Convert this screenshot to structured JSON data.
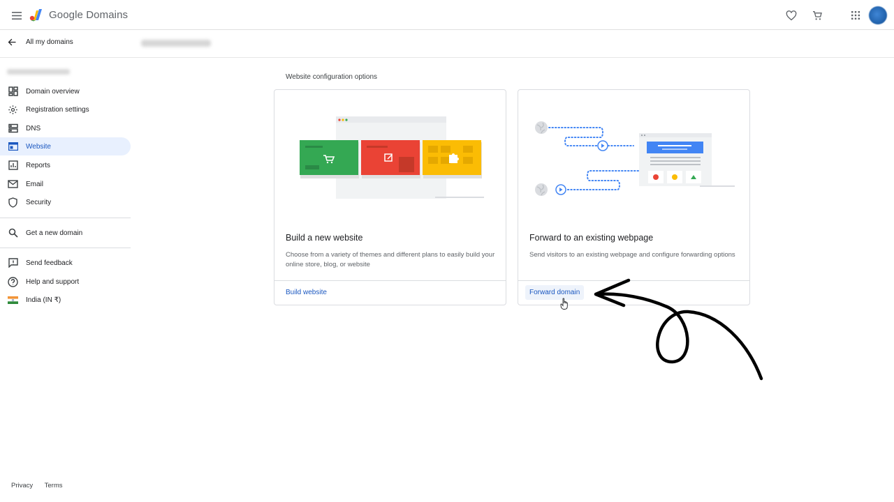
{
  "app": {
    "logo_text": "Google Domains"
  },
  "header": {
    "icons": [
      "menu-icon",
      "favorites-heart-icon",
      "cart-icon",
      "apps-grid-icon",
      "account-avatar"
    ]
  },
  "subbar": {
    "back_label": "All my domains"
  },
  "sidebar": {
    "items": [
      {
        "label": "Domain overview",
        "icon": "dashboard-icon"
      },
      {
        "label": "Registration settings",
        "icon": "settings-gear-icon"
      },
      {
        "label": "DNS",
        "icon": "dns-icon"
      },
      {
        "label": "Website",
        "icon": "website-icon",
        "active": true
      },
      {
        "label": "Reports",
        "icon": "reports-icon"
      },
      {
        "label": "Email",
        "icon": "email-icon"
      },
      {
        "label": "Security",
        "icon": "shield-icon"
      }
    ],
    "secondary": [
      {
        "label": "Get a new domain",
        "icon": "search-icon"
      }
    ],
    "tertiary": [
      {
        "label": "Send feedback",
        "icon": "feedback-icon"
      },
      {
        "label": "Help and support",
        "icon": "help-icon"
      },
      {
        "label": "India (IN ₹)",
        "icon": "india-flag-icon"
      }
    ]
  },
  "main": {
    "section_title": "Website configuration options",
    "cards": [
      {
        "title": "Build a new website",
        "description": "Choose from a variety of themes and different plans to easily build your online store, blog, or website",
        "action": "Build website"
      },
      {
        "title": "Forward to an existing webpage",
        "description": "Send visitors to an existing webpage and configure forwarding options",
        "action": "Forward domain"
      }
    ]
  },
  "footer": {
    "privacy": "Privacy",
    "terms": "Terms"
  },
  "colors": {
    "accent": "#1a57c0",
    "active_bg": "#e8f0fe",
    "green": "#34a853",
    "red": "#ea4335",
    "yellow": "#fbbc04",
    "blue": "#4285f4"
  }
}
